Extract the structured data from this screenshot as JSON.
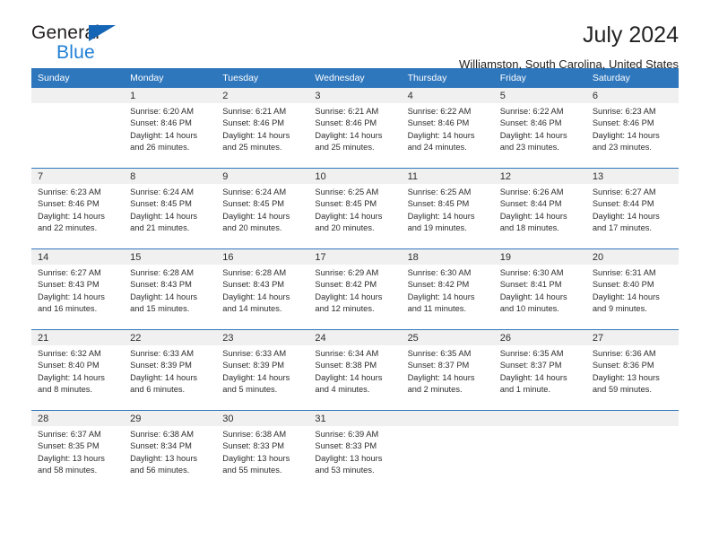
{
  "brand": {
    "word_one": "General",
    "word_two": "Blue",
    "triangle_icon": "triangle-icon",
    "accent_color": "#1565b6"
  },
  "header": {
    "title": "July 2024",
    "subtitle": "Williamston, South Carolina, United States"
  },
  "calendar": {
    "header_background": "#2f77bd",
    "daynum_band_background": "#f0f0f0",
    "weekday_headers": [
      "Sunday",
      "Monday",
      "Tuesday",
      "Wednesday",
      "Thursday",
      "Friday",
      "Saturday"
    ],
    "weeks": [
      [
        {
          "day": "",
          "sunrise": "",
          "sunset": "",
          "daylight_line1": "",
          "daylight_line2": "",
          "blank": true
        },
        {
          "day": "1",
          "sunrise": "Sunrise: 6:20 AM",
          "sunset": "Sunset: 8:46 PM",
          "daylight_line1": "Daylight: 14 hours",
          "daylight_line2": "and 26 minutes."
        },
        {
          "day": "2",
          "sunrise": "Sunrise: 6:21 AM",
          "sunset": "Sunset: 8:46 PM",
          "daylight_line1": "Daylight: 14 hours",
          "daylight_line2": "and 25 minutes."
        },
        {
          "day": "3",
          "sunrise": "Sunrise: 6:21 AM",
          "sunset": "Sunset: 8:46 PM",
          "daylight_line1": "Daylight: 14 hours",
          "daylight_line2": "and 25 minutes."
        },
        {
          "day": "4",
          "sunrise": "Sunrise: 6:22 AM",
          "sunset": "Sunset: 8:46 PM",
          "daylight_line1": "Daylight: 14 hours",
          "daylight_line2": "and 24 minutes."
        },
        {
          "day": "5",
          "sunrise": "Sunrise: 6:22 AM",
          "sunset": "Sunset: 8:46 PM",
          "daylight_line1": "Daylight: 14 hours",
          "daylight_line2": "and 23 minutes."
        },
        {
          "day": "6",
          "sunrise": "Sunrise: 6:23 AM",
          "sunset": "Sunset: 8:46 PM",
          "daylight_line1": "Daylight: 14 hours",
          "daylight_line2": "and 23 minutes."
        }
      ],
      [
        {
          "day": "7",
          "sunrise": "Sunrise: 6:23 AM",
          "sunset": "Sunset: 8:46 PM",
          "daylight_line1": "Daylight: 14 hours",
          "daylight_line2": "and 22 minutes."
        },
        {
          "day": "8",
          "sunrise": "Sunrise: 6:24 AM",
          "sunset": "Sunset: 8:45 PM",
          "daylight_line1": "Daylight: 14 hours",
          "daylight_line2": "and 21 minutes."
        },
        {
          "day": "9",
          "sunrise": "Sunrise: 6:24 AM",
          "sunset": "Sunset: 8:45 PM",
          "daylight_line1": "Daylight: 14 hours",
          "daylight_line2": "and 20 minutes."
        },
        {
          "day": "10",
          "sunrise": "Sunrise: 6:25 AM",
          "sunset": "Sunset: 8:45 PM",
          "daylight_line1": "Daylight: 14 hours",
          "daylight_line2": "and 20 minutes."
        },
        {
          "day": "11",
          "sunrise": "Sunrise: 6:25 AM",
          "sunset": "Sunset: 8:45 PM",
          "daylight_line1": "Daylight: 14 hours",
          "daylight_line2": "and 19 minutes."
        },
        {
          "day": "12",
          "sunrise": "Sunrise: 6:26 AM",
          "sunset": "Sunset: 8:44 PM",
          "daylight_line1": "Daylight: 14 hours",
          "daylight_line2": "and 18 minutes."
        },
        {
          "day": "13",
          "sunrise": "Sunrise: 6:27 AM",
          "sunset": "Sunset: 8:44 PM",
          "daylight_line1": "Daylight: 14 hours",
          "daylight_line2": "and 17 minutes."
        }
      ],
      [
        {
          "day": "14",
          "sunrise": "Sunrise: 6:27 AM",
          "sunset": "Sunset: 8:43 PM",
          "daylight_line1": "Daylight: 14 hours",
          "daylight_line2": "and 16 minutes."
        },
        {
          "day": "15",
          "sunrise": "Sunrise: 6:28 AM",
          "sunset": "Sunset: 8:43 PM",
          "daylight_line1": "Daylight: 14 hours",
          "daylight_line2": "and 15 minutes."
        },
        {
          "day": "16",
          "sunrise": "Sunrise: 6:28 AM",
          "sunset": "Sunset: 8:43 PM",
          "daylight_line1": "Daylight: 14 hours",
          "daylight_line2": "and 14 minutes."
        },
        {
          "day": "17",
          "sunrise": "Sunrise: 6:29 AM",
          "sunset": "Sunset: 8:42 PM",
          "daylight_line1": "Daylight: 14 hours",
          "daylight_line2": "and 12 minutes."
        },
        {
          "day": "18",
          "sunrise": "Sunrise: 6:30 AM",
          "sunset": "Sunset: 8:42 PM",
          "daylight_line1": "Daylight: 14 hours",
          "daylight_line2": "and 11 minutes."
        },
        {
          "day": "19",
          "sunrise": "Sunrise: 6:30 AM",
          "sunset": "Sunset: 8:41 PM",
          "daylight_line1": "Daylight: 14 hours",
          "daylight_line2": "and 10 minutes."
        },
        {
          "day": "20",
          "sunrise": "Sunrise: 6:31 AM",
          "sunset": "Sunset: 8:40 PM",
          "daylight_line1": "Daylight: 14 hours",
          "daylight_line2": "and 9 minutes."
        }
      ],
      [
        {
          "day": "21",
          "sunrise": "Sunrise: 6:32 AM",
          "sunset": "Sunset: 8:40 PM",
          "daylight_line1": "Daylight: 14 hours",
          "daylight_line2": "and 8 minutes."
        },
        {
          "day": "22",
          "sunrise": "Sunrise: 6:33 AM",
          "sunset": "Sunset: 8:39 PM",
          "daylight_line1": "Daylight: 14 hours",
          "daylight_line2": "and 6 minutes."
        },
        {
          "day": "23",
          "sunrise": "Sunrise: 6:33 AM",
          "sunset": "Sunset: 8:39 PM",
          "daylight_line1": "Daylight: 14 hours",
          "daylight_line2": "and 5 minutes."
        },
        {
          "day": "24",
          "sunrise": "Sunrise: 6:34 AM",
          "sunset": "Sunset: 8:38 PM",
          "daylight_line1": "Daylight: 14 hours",
          "daylight_line2": "and 4 minutes."
        },
        {
          "day": "25",
          "sunrise": "Sunrise: 6:35 AM",
          "sunset": "Sunset: 8:37 PM",
          "daylight_line1": "Daylight: 14 hours",
          "daylight_line2": "and 2 minutes."
        },
        {
          "day": "26",
          "sunrise": "Sunrise: 6:35 AM",
          "sunset": "Sunset: 8:37 PM",
          "daylight_line1": "Daylight: 14 hours",
          "daylight_line2": "and 1 minute."
        },
        {
          "day": "27",
          "sunrise": "Sunrise: 6:36 AM",
          "sunset": "Sunset: 8:36 PM",
          "daylight_line1": "Daylight: 13 hours",
          "daylight_line2": "and 59 minutes."
        }
      ],
      [
        {
          "day": "28",
          "sunrise": "Sunrise: 6:37 AM",
          "sunset": "Sunset: 8:35 PM",
          "daylight_line1": "Daylight: 13 hours",
          "daylight_line2": "and 58 minutes."
        },
        {
          "day": "29",
          "sunrise": "Sunrise: 6:38 AM",
          "sunset": "Sunset: 8:34 PM",
          "daylight_line1": "Daylight: 13 hours",
          "daylight_line2": "and 56 minutes."
        },
        {
          "day": "30",
          "sunrise": "Sunrise: 6:38 AM",
          "sunset": "Sunset: 8:33 PM",
          "daylight_line1": "Daylight: 13 hours",
          "daylight_line2": "and 55 minutes."
        },
        {
          "day": "31",
          "sunrise": "Sunrise: 6:39 AM",
          "sunset": "Sunset: 8:33 PM",
          "daylight_line1": "Daylight: 13 hours",
          "daylight_line2": "and 53 minutes."
        },
        {
          "day": "",
          "sunrise": "",
          "sunset": "",
          "daylight_line1": "",
          "daylight_line2": "",
          "blank": true
        },
        {
          "day": "",
          "sunrise": "",
          "sunset": "",
          "daylight_line1": "",
          "daylight_line2": "",
          "blank": true
        },
        {
          "day": "",
          "sunrise": "",
          "sunset": "",
          "daylight_line1": "",
          "daylight_line2": "",
          "blank": true
        }
      ]
    ]
  }
}
